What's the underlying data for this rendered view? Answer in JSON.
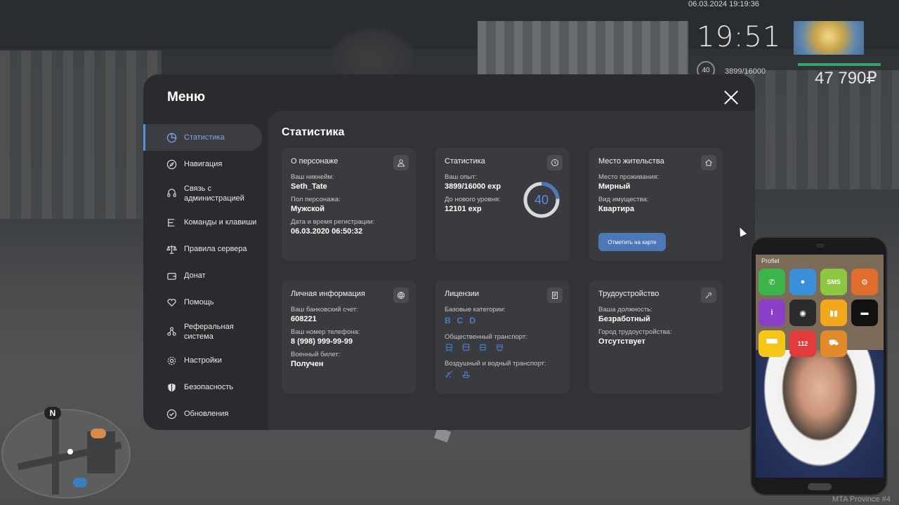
{
  "hud": {
    "datetime": "06.03.2024 19:19:36",
    "clock": "19:51",
    "level": "40",
    "exp": "3899/16000",
    "money": "47 790₽"
  },
  "menu": {
    "title": "Меню",
    "content_title": "Статистика",
    "sidebar": [
      {
        "label": "Статистика",
        "icon": "pie-chart-icon",
        "active": true
      },
      {
        "label": "Навигация",
        "icon": "compass-icon"
      },
      {
        "label": "Связь с администрацией",
        "icon": "headset-icon"
      },
      {
        "label": "Команды и клавиши",
        "icon": "list-icon"
      },
      {
        "label": "Правила сервера",
        "icon": "scales-icon"
      },
      {
        "label": "Донат",
        "icon": "wallet-icon"
      },
      {
        "label": "Помощь",
        "icon": "heart-hands-icon"
      },
      {
        "label": "Реферальная система",
        "icon": "network-icon"
      },
      {
        "label": "Настройки",
        "icon": "gear-icon"
      },
      {
        "label": "Безопасность",
        "icon": "shield-icon"
      },
      {
        "label": "Обновления",
        "icon": "check-circle-icon"
      }
    ],
    "cards": {
      "character": {
        "title": "О персонаже",
        "nick_label": "Ваш никнейм:",
        "nick": "Seth_Tate",
        "gender_label": "Пол персонажа:",
        "gender": "Мужской",
        "reg_label": "Дата и время регистрации:",
        "reg": "06.03.2020 06:50:32"
      },
      "stats": {
        "title": "Статистика",
        "exp_label": "Ваш опыт:",
        "exp": "3899/16000 exp",
        "next_label": "До нового уровня:",
        "next": "12101 exp",
        "level": "40",
        "progress": 0.24
      },
      "residence": {
        "title": "Место жительства",
        "place_label": "Место проживания:",
        "place": "Мирный",
        "property_label": "Вид имущества:",
        "property": "Квартира",
        "map_button": "Отметить на карте"
      },
      "personal": {
        "title": "Личная информация",
        "bank_label": "Ваш банковский счет:",
        "bank": "608221",
        "phone_label": "Ваш номер телефона:",
        "phone": "8 (998) 999-99-99",
        "military_label": "Военный билет:",
        "military": "Получен"
      },
      "licenses": {
        "title": "Лицензии",
        "base_label": "Базовые категории:",
        "categories": [
          "B",
          "C",
          "D"
        ],
        "public_label": "Общественный транспорт:",
        "air_label": "Воздушный и водный транспорт:"
      },
      "employment": {
        "title": "Трудоустройство",
        "position_label": "Ваша должность:",
        "position": "Безработный",
        "city_label": "Город трудоустройства:",
        "city": "Отсутствует"
      }
    }
  },
  "minimap": {
    "compass": "N"
  },
  "phone": {
    "carrier": "Profiel",
    "apps": [
      {
        "name": "phone-app",
        "color": "#3bb54a",
        "glyph": "✆"
      },
      {
        "name": "contacts-app",
        "color": "#3a8fd9",
        "glyph": "●"
      },
      {
        "name": "sms-app",
        "color": "#8dc63f",
        "glyph": "SMS"
      },
      {
        "name": "settings-app",
        "color": "#e06d2c",
        "glyph": "⚙"
      },
      {
        "name": "info-app",
        "color": "#8a3fc6",
        "glyph": "i"
      },
      {
        "name": "card-app",
        "color": "#2b2b2b",
        "glyph": "◉"
      },
      {
        "name": "stats-app",
        "color": "#f2a81d",
        "glyph": "▮▮"
      },
      {
        "name": "bed-app",
        "color": "#111111",
        "glyph": "▬"
      },
      {
        "name": "taxi-app",
        "color": "#f5c518",
        "glyph": "▀▀"
      },
      {
        "name": "emergency-app",
        "color": "#e23b3b",
        "glyph": "112"
      },
      {
        "name": "tow-app",
        "color": "#e08a2c",
        "glyph": "⛟"
      }
    ]
  },
  "watermark": "MTA Province #4"
}
